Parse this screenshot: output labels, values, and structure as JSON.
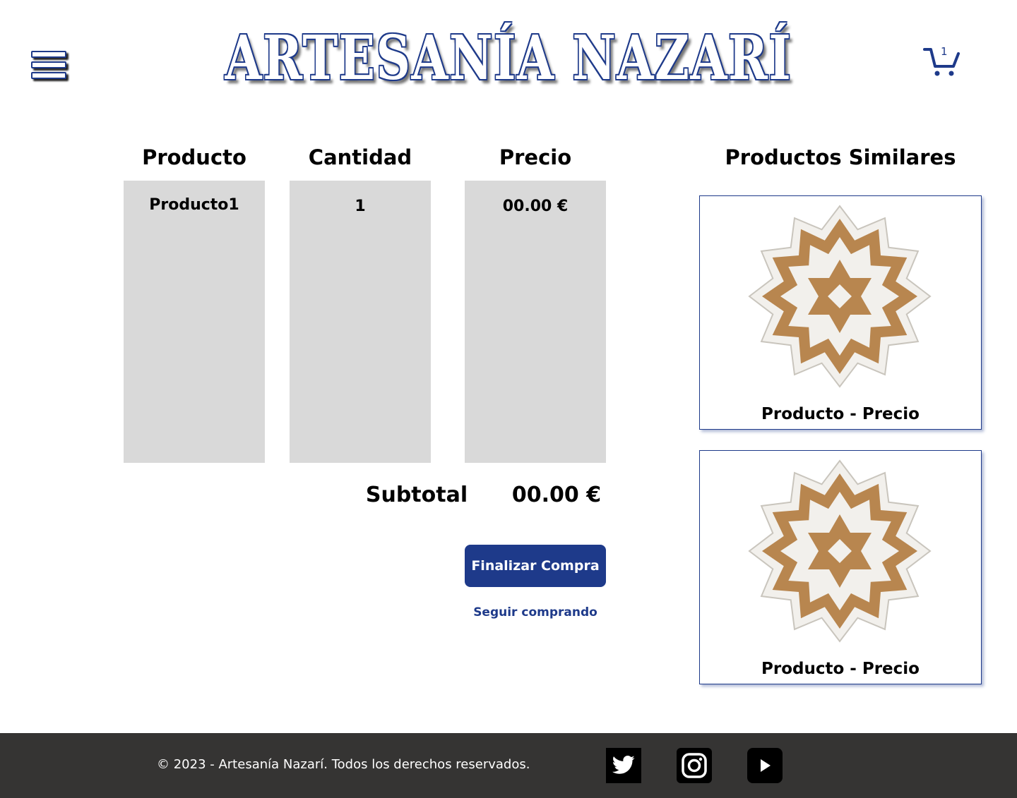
{
  "header": {
    "logo_text": "ARTESANÍA NAZARÍ",
    "menu_icon": "hamburger-menu-icon",
    "cart_icon": "shopping-cart-icon",
    "cart_count": "1"
  },
  "cart": {
    "headers": {
      "product": "Producto",
      "quantity": "Cantidad",
      "price": "Precio"
    },
    "items": [
      {
        "product": "Producto1",
        "quantity": "1",
        "price": "00.00 €"
      }
    ],
    "subtotal_label": "Subtotal",
    "subtotal_value": "00.00 €",
    "checkout_label": "Finalizar Compra",
    "continue_label": "Seguir comprando"
  },
  "similar": {
    "title": "Productos Similares",
    "products": [
      {
        "caption": "Producto - Precio",
        "image_icon": "nasrid-star-tile-image"
      },
      {
        "caption": "Producto - Precio",
        "image_icon": "nasrid-star-tile-image"
      }
    ]
  },
  "footer": {
    "copyright": "© 2023 - Artesanía Nazarí. Todos los derechos reservados.",
    "social": [
      "twitter-icon",
      "instagram-icon",
      "youtube-icon"
    ]
  },
  "colors": {
    "accent": "#1e3a8a",
    "cell_bg": "#d9d9d9",
    "footer_bg": "#353433",
    "tile_gold": "#b8864f",
    "tile_white": "#f2f0ec"
  }
}
